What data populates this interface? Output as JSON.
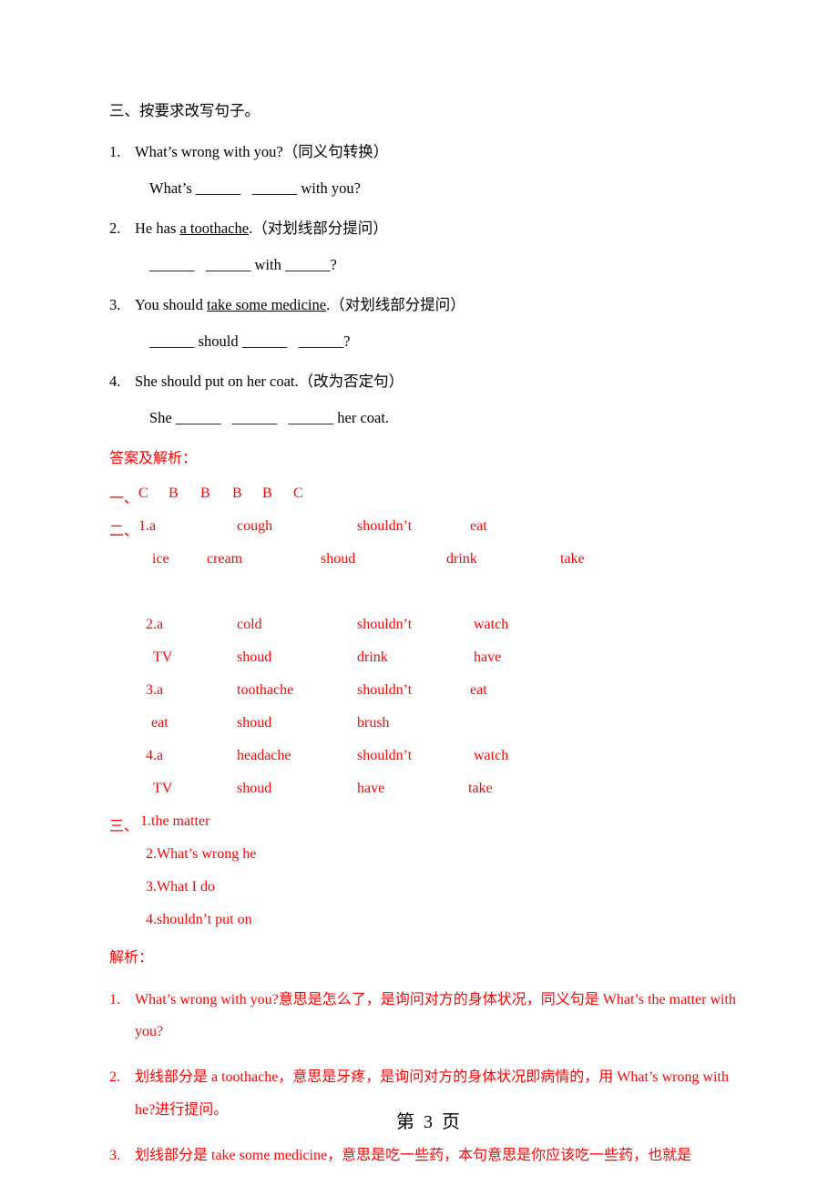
{
  "document": {
    "section3": {
      "heading": "三、按要求改写句子。",
      "questions": [
        {
          "num": "1.",
          "prompt_pre": "What’s wrong with you?",
          "prompt_paren": "（同义句转换）",
          "answer_line": "What’s ______   ______ with you?"
        },
        {
          "num": "2.",
          "prompt_pre": "He has ",
          "prompt_underlined": "a toothache",
          "prompt_post": ".",
          "prompt_paren": "（对划线部分提问）",
          "answer_line": "______   ______ with ______?"
        },
        {
          "num": "3.",
          "prompt_pre": "You should ",
          "prompt_underlined": "take some medicine",
          "prompt_post": ".",
          "prompt_paren": "（对划线部分提问）",
          "answer_line": "______ should ______   ______?"
        },
        {
          "num": "4.",
          "prompt_pre": "She should put on her coat.",
          "prompt_paren": "（改为否定句）",
          "answer_line": "She ______   ______   ______ her coat."
        }
      ]
    },
    "answer_key": {
      "heading": "答案及解析：",
      "section1": {
        "label": "一、",
        "answers": [
          "C",
          "B",
          "B",
          "B",
          "B",
          "C"
        ]
      },
      "section2": {
        "label": "二、",
        "groups": [
          {
            "row1": [
              "1.a",
              "cough",
              "shouldn’t",
              "eat"
            ],
            "row2": [
              "ice",
              "cream",
              "shoud",
              "drink",
              "take"
            ]
          },
          {
            "row1": [
              "2.a",
              "cold",
              "shouldn’t",
              "watch"
            ],
            "row2": [
              "TV",
              "shoud",
              "drink",
              "have"
            ]
          },
          {
            "row1": [
              "3.a",
              "toothache",
              "shouldn’t",
              "eat"
            ],
            "row2": [
              "eat",
              "shoud",
              "brush"
            ]
          },
          {
            "row1": [
              "4.a",
              "headache",
              "shouldn’t",
              "watch"
            ],
            "row2": [
              "TV",
              "shoud",
              "have",
              "take"
            ]
          }
        ]
      },
      "section3": {
        "label": "三、",
        "items": [
          "1.the matter",
          "2.What’s wrong he",
          "3.What I do",
          "4.shouldn’t put on"
        ]
      }
    },
    "explanation": {
      "heading": "解析：",
      "items": [
        {
          "num": "1.",
          "text": "What’s wrong with you?意思是怎么了，是询问对方的身体状况，同义句是 What’s the matter with you?"
        },
        {
          "num": "2.",
          "text": "划线部分是 a toothache，意思是牙疼，是询问对方的身体状况即病情的，用 What’s wrong with he?进行提问。"
        },
        {
          "num": "3.",
          "text": "划线部分是 take some medicine，意思是吃一些药，本句意思是你应该吃一些药，也就是"
        }
      ]
    },
    "footer": {
      "page_label": "第  3  页"
    }
  }
}
